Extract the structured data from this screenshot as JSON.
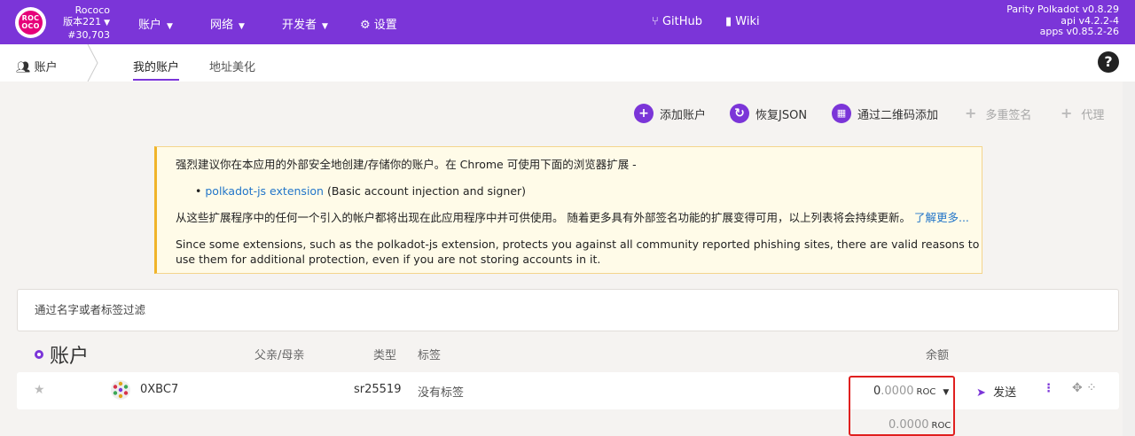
{
  "chain": {
    "name": "Rococo",
    "version": "版本221",
    "block": "#30,703",
    "logo": "ROC OCO"
  },
  "nav": {
    "accounts": "账户",
    "network": "网络",
    "developer": "开发者",
    "settings": "设置",
    "github": "GitHub",
    "wiki": "Wiki"
  },
  "versions": {
    "line1": "Parity Polkadot v0.8.29",
    "line2": "api v4.2.2-4",
    "line3": "apps v0.85.2-26"
  },
  "subnav": {
    "crumb": "账户",
    "tab_my": "我的账户",
    "tab_vanity": "地址美化",
    "help": "?"
  },
  "actions": {
    "add": "添加账户",
    "restore": "恢复JSON",
    "qr": "通过二维码添加",
    "multisig": "多重签名",
    "proxy": "代理"
  },
  "notice": {
    "p1": "强烈建议你在本应用的外部安全地创建/存储你的账户。在 Chrome 可使用下面的浏览器扩展 -",
    "ext_link": "polkadot-js extension",
    "ext_desc": " (Basic account injection and signer)",
    "p2": "从这些扩展程序中的任何一个引入的帐户都将出现在此应用程序中并可供使用。 随着更多具有外部签名功能的扩展变得可用，以上列表将会持续更新。",
    "learn_more": "了解更多...",
    "p3": "Since some extensions, such as the polkadot-js extension, protects you against all community reported phishing sites, there are valid reasons to use them for additional protection, even if you are not storing accounts in it."
  },
  "filter": {
    "placeholder": "通过名字或者标签过滤"
  },
  "table": {
    "title": "账户",
    "col_parent": "父亲/母亲",
    "col_type": "类型",
    "col_tags": "标签",
    "col_balance": "余额"
  },
  "account": {
    "name": "0XBC7",
    "type": "sr25519",
    "tags": "没有标签",
    "balance_int": "0",
    "balance_dec": ".0000",
    "unit": "ROC",
    "send": "发送"
  },
  "colors": {
    "accent": "#7b35d8",
    "highlight": "#e0201f"
  }
}
